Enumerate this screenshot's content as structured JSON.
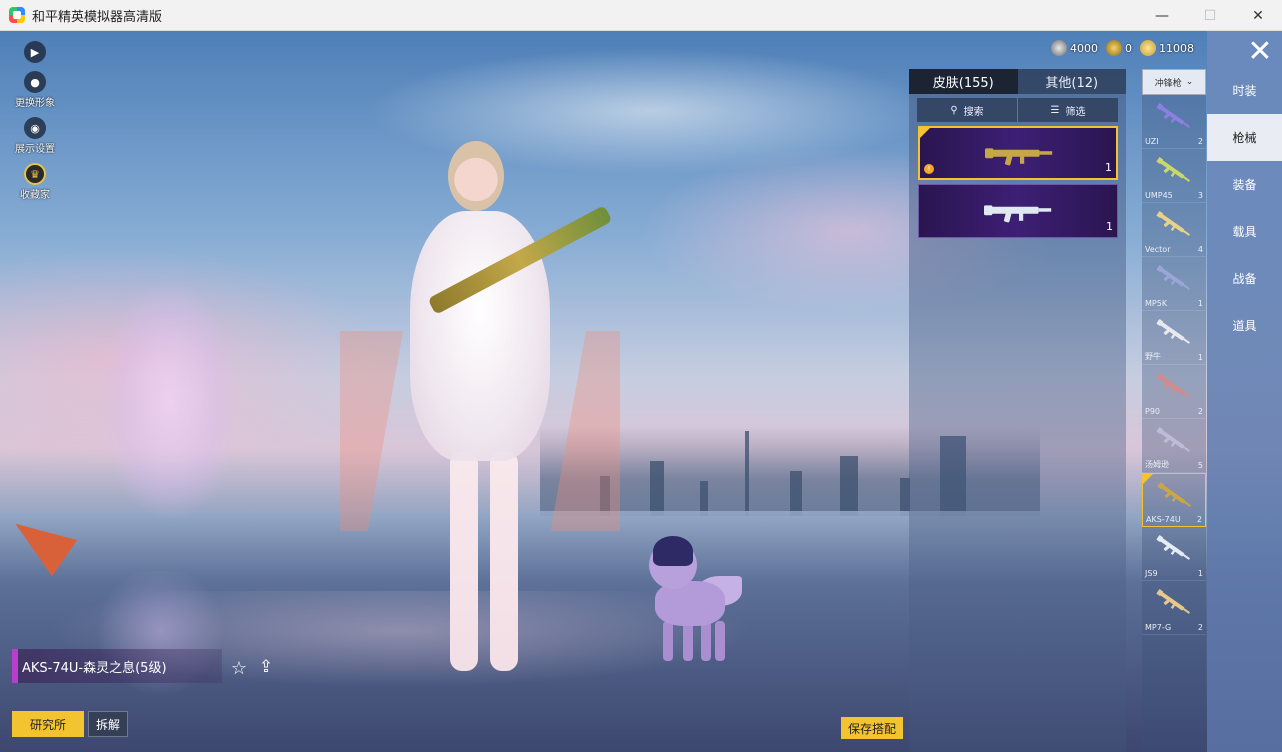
{
  "window": {
    "title": "和平精英模拟器高清版",
    "controls": {
      "minimize": "—",
      "maximize": "☐",
      "close": "✕"
    }
  },
  "left_tools": [
    {
      "label": "",
      "icon": "play-icon"
    },
    {
      "label": "更换形象",
      "icon": "avatar-icon"
    },
    {
      "label": "展示设置",
      "icon": "eye-icon"
    },
    {
      "label": "收藏家",
      "icon": "collector-badge-icon"
    }
  ],
  "currencies": [
    {
      "value": "4000",
      "icon": "silver-coin-icon"
    },
    {
      "value": "0",
      "icon": "gold-badge-icon"
    },
    {
      "value": "11008",
      "icon": "coin-icon"
    }
  ],
  "close_glyph": "✕",
  "categories": [
    {
      "label": "时装",
      "active": false
    },
    {
      "label": "枪械",
      "active": true
    },
    {
      "label": "装备",
      "active": false
    },
    {
      "label": "载具",
      "active": false
    },
    {
      "label": "战备",
      "active": false
    },
    {
      "label": "道具",
      "active": false
    }
  ],
  "skin_panel": {
    "tabs": [
      {
        "label": "皮肤(155)",
        "active": true
      },
      {
        "label": "其他(12)",
        "active": false
      }
    ],
    "search_label": "搜索",
    "filter_label": "筛选",
    "cards": [
      {
        "count": "1",
        "selected": true,
        "badge": "!",
        "color": "#c7a64a"
      },
      {
        "count": "1",
        "selected": false,
        "badge": "",
        "color": "#dfe9f2"
      }
    ]
  },
  "weapon_list": {
    "dropdown_label": "冲锋枪",
    "items": [
      {
        "name": "UZI",
        "count": "2",
        "selected": false,
        "color": "#8d7fe0"
      },
      {
        "name": "UMP45",
        "count": "3",
        "selected": false,
        "color": "#c9d86a"
      },
      {
        "name": "Vector",
        "count": "4",
        "selected": false,
        "color": "#e8d28a"
      },
      {
        "name": "MP5K",
        "count": "1",
        "selected": false,
        "color": "#9ba5d8"
      },
      {
        "name": "野牛",
        "count": "1",
        "selected": false,
        "color": "#e8e8f0"
      },
      {
        "name": "P90",
        "count": "2",
        "selected": false,
        "color": "#d28a8a"
      },
      {
        "name": "汤姆逊",
        "count": "5",
        "selected": false,
        "color": "#bcbcd8"
      },
      {
        "name": "AKS-74U",
        "count": "2",
        "selected": true,
        "color": "#c9a646"
      },
      {
        "name": "JS9",
        "count": "1",
        "selected": false,
        "color": "#e6ecf5"
      },
      {
        "name": "MP7-G",
        "count": "2",
        "selected": false,
        "color": "#e8c88a"
      }
    ]
  },
  "bottom": {
    "skin_name": "AKS-74U-森灵之息(5级)",
    "research_label": "研究所",
    "dismantle_label": "拆解",
    "save_label": "保存搭配"
  }
}
